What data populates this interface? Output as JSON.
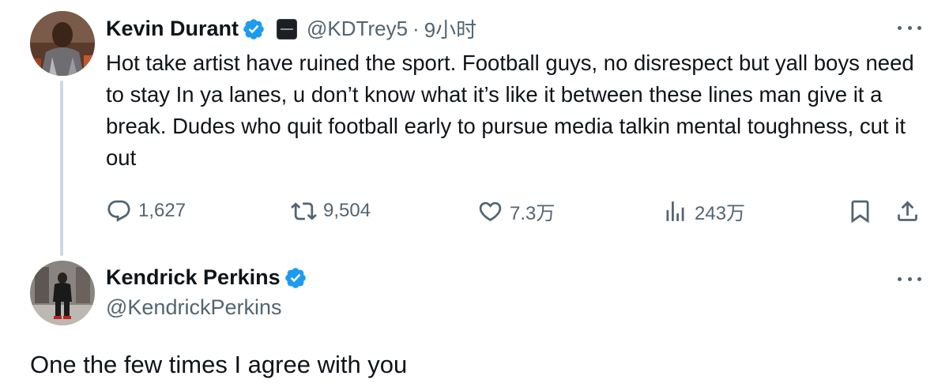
{
  "tweet": {
    "author": {
      "display_name": "Kevin Durant",
      "handle": "@KDTrey5",
      "verified": true,
      "affiliation_badge": "boardroom-badge-icon"
    },
    "separator": "·",
    "time": "9小时",
    "text": "Hot take artist have ruined the sport. Football guys, no disrespect but yall boys need to stay In ya lanes, u don’t know what it’s like it between these lines man give it a break. Dudes who quit football early to pursue media talkin mental toughness, cut it out",
    "stats": {
      "replies": "1,627",
      "reposts": "9,504",
      "likes": "7.3万",
      "views": "243万"
    },
    "icons": [
      "reply-icon",
      "repost-icon",
      "like-icon",
      "views-icon",
      "bookmark-icon",
      "share-icon",
      "more-icon"
    ]
  },
  "reply": {
    "author": {
      "display_name": "Kendrick Perkins",
      "handle": "@KendrickPerkins",
      "verified": true
    },
    "text": "One the few times I agree with you"
  },
  "colors": {
    "text_primary": "#0f1419",
    "text_secondary": "#536471",
    "verified_blue": "#1d9bf0",
    "thread_line": "#cfd9de"
  }
}
